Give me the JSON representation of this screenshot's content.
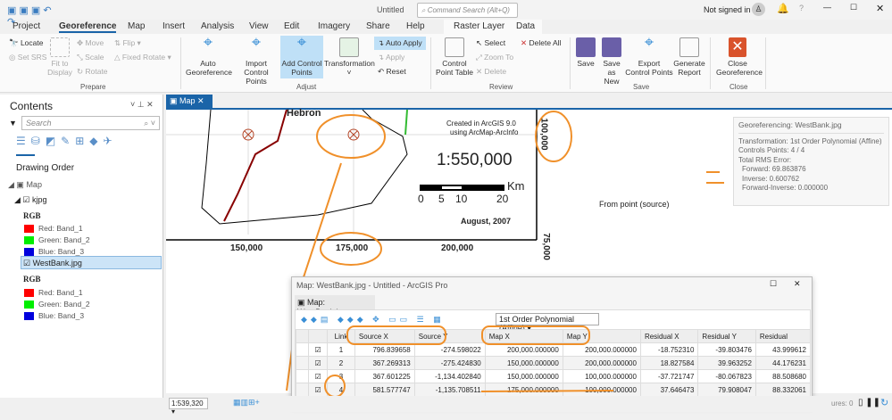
{
  "titlebar": {
    "doc_title": "Untitled",
    "search_placeholder": "Command Search (Alt+Q)",
    "user": "Not signed in"
  },
  "tabs": [
    "Project",
    "Georeference",
    "Map",
    "Insert",
    "Analysis",
    "View",
    "Edit",
    "Imagery",
    "Share",
    "Help",
    "Raster Layer",
    "Data"
  ],
  "ribbon": {
    "prepare": {
      "label": "Prepare",
      "locate": "Locate",
      "set_srs": "Set SRS",
      "fit": "Fit to Display",
      "move": "Move",
      "scale": "Scale",
      "rotate": "Rotate",
      "flip": "Flip",
      "fixed_rotate": "Fixed Rotate"
    },
    "adjust": {
      "label": "Adjust",
      "auto_geo": "Auto Georeference",
      "import": "Import Control Points",
      "add": "Add Control Points",
      "transformation": "Transformation",
      "auto_apply": "Auto Apply",
      "apply": "Apply",
      "reset": "Reset"
    },
    "review": {
      "label": "Review",
      "table": "Control Point Table",
      "select": "Select",
      "zoom_to": "Zoom To",
      "delete": "Delete",
      "delete_all": "Delete All"
    },
    "save": {
      "label": "Save",
      "save": "Save",
      "save_new": "Save as New",
      "export": "Export Control Points",
      "report": "Generate Report"
    },
    "close": {
      "label": "Close",
      "close": "Close Georeference"
    }
  },
  "contents": {
    "title": "Contents",
    "search_placeholder": "Search",
    "drawing_order": "Drawing Order",
    "map": "Map",
    "layers": [
      {
        "name": "kjpg",
        "rgb": "RGB",
        "bands": [
          {
            "label": "Red:  Band_1",
            "color": "#ff0000"
          },
          {
            "label": "Green: Band_2",
            "color": "#00ee00"
          },
          {
            "label": "Blue:  Band_3",
            "color": "#0000dd"
          }
        ]
      },
      {
        "name": "WestBank.jpg",
        "rgb": "RGB",
        "bands": [
          {
            "label": "Red:  Band_1",
            "color": "#ff0000"
          },
          {
            "label": "Green: Band_2",
            "color": "#00ee00"
          },
          {
            "label": "Blue:  Band_3",
            "color": "#0000dd"
          }
        ]
      }
    ]
  },
  "map": {
    "tab": "Map",
    "city": "Hebron",
    "created": "Created in ArcGIS 9.0",
    "using": "using ArcMap-ArcInfo",
    "scale_text": "1:550,000",
    "km": "Km",
    "scale_ticks": [
      "0",
      "5",
      "10",
      "20"
    ],
    "date": "August, 2007",
    "x_ticks": [
      "150,000",
      "175,000",
      "200,000"
    ],
    "y_ticks": [
      "100,000",
      "75,000"
    ],
    "from_point": "From point (source)",
    "status_scale": "1:539,320",
    "features": "ures: 0"
  },
  "info": {
    "title": "Georeferencing: WestBank.jpg",
    "transformation": "Transformation: 1st Order Polynomial (Affine)",
    "controls": "Controls Points: 4 / 4",
    "rms": "Total RMS Error:",
    "forward": "Forward: 69.863876",
    "inverse": "Inverse: 0.600762",
    "fi": "Forward-Inverse: 0.000000"
  },
  "dialog": {
    "title": "Map: WestBank.jpg - Untitled - ArcGIS Pro",
    "tab": "Map: WestBank.jpg",
    "transform": "1st Order Polynomial (Affine)",
    "columns": [
      "Link",
      "Source X",
      "Source Y",
      "Map X",
      "Map Y",
      "Residual X",
      "Residual Y",
      "Residual"
    ],
    "rows": [
      [
        "1",
        "796.839658",
        "-274.598022",
        "200,000.000000",
        "200,000.000000",
        "-18.752310",
        "-39.803476",
        "43.999612"
      ],
      [
        "2",
        "367.269313",
        "-275.424830",
        "150,000.000000",
        "200,000.000000",
        "18.827584",
        "39.963252",
        "44.176231"
      ],
      [
        "3",
        "367.601225",
        "-1,134.402840",
        "150,000.000000",
        "100,000.000000",
        "-37.721747",
        "-80.067823",
        "88.508680"
      ],
      [
        "4",
        "581.577747",
        "-1,135.708511",
        "175,000.000000",
        "100,000.000000",
        "37.646473",
        "79.908047",
        "88.332061"
      ]
    ]
  },
  "colors": {
    "accent": "#1a64a8",
    "annotation": "#f0902a",
    "selected": "#cce4f7"
  }
}
